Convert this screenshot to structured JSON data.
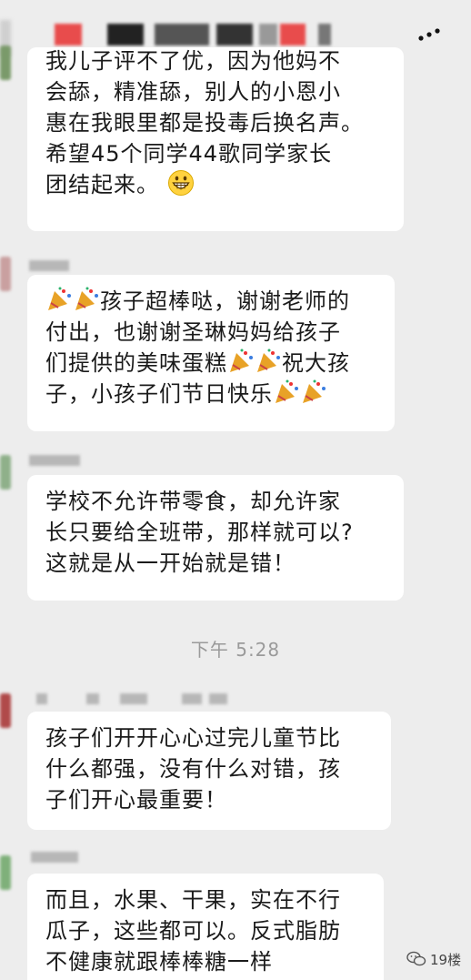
{
  "chat": {
    "messages": [
      {
        "lines": [
          "我儿子评不了优，因为他妈不",
          "会舔，精准舔，别人的小恩小",
          "惠在我眼里都是投毒后换名声。",
          "希望45个同学44歌同学家长",
          "团结起来。"
        ],
        "trailing_emoji": "grinning-face-emoji"
      },
      {
        "lines": [
          "孩子超棒哒，谢谢老师的",
          "付出，也谢谢圣琳妈妈给孩子",
          "们提供的美味蛋糕",
          "子，小孩子们节日快乐"
        ],
        "line3_tail": "祝大孩"
      },
      {
        "lines": [
          "学校不允许带零食，却允许家",
          "长只要给全班带，那样就可以?",
          "这就是从一开始就是错！"
        ]
      },
      {
        "lines": [
          "孩子们开开心心过完儿童节比",
          "什么都强，没有什么对错，孩",
          "子们开心最重要！"
        ]
      },
      {
        "lines": [
          "而且，水果、干果，实在不行",
          "瓜子，这些都可以。反式脂肪",
          "不健康就跟棒棒糖一样"
        ]
      }
    ],
    "timestamp": "下午 5:28"
  },
  "watermark": {
    "text": "19楼"
  },
  "colors": {
    "background": "#ededed",
    "bubble": "#ffffff",
    "text": "#1b1b1b",
    "timestamp": "#9a9a9a"
  }
}
